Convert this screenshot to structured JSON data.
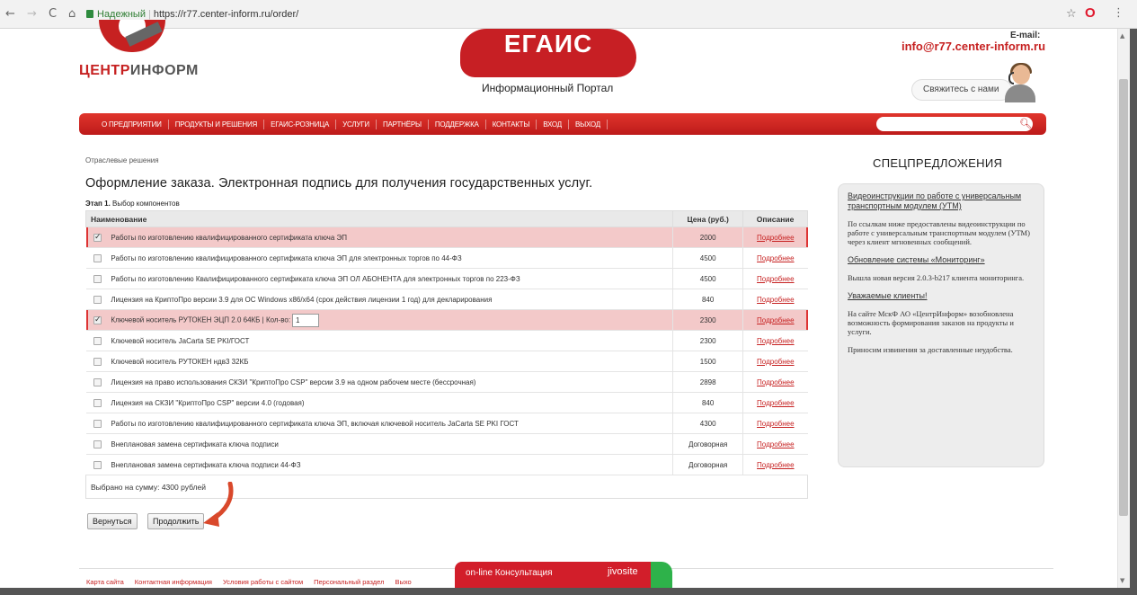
{
  "browser": {
    "back": "←",
    "forward": "→",
    "reload": "C",
    "home": "⌂",
    "secure_label": "Надежный",
    "url": "https://r77.center-inform.ru/order/",
    "star": "☆",
    "opera": "O",
    "menu": "⋮"
  },
  "header": {
    "logo_part1": "ЦЕНТР",
    "logo_part2": "ИНФОРМ",
    "egais": "ЕГАИС",
    "portal": "Информационный Портал",
    "email_label": "E-mail:",
    "email": "info@r77.center-inform.ru",
    "contact_button": "Свяжитесь с нами"
  },
  "nav": {
    "items": [
      "О ПРЕДПРИЯТИИ",
      "ПРОДУКТЫ И РЕШЕНИЯ",
      "ЕГАИС-РОЗНИЦА",
      "УСЛУГИ",
      "ПАРТНЁРЫ",
      "ПОДДЕРЖКА",
      "КОНТАКТЫ",
      "ВХОД",
      "ВЫХОД"
    ],
    "search_placeholder": ""
  },
  "main": {
    "breadcrumb": "Отраслевые решения",
    "title": "Оформление заказа. Электронная подпись для получения государственных услуг.",
    "stage_num": "Этап 1.",
    "stage_text": " Выбор компонентов",
    "table": {
      "headers": {
        "name": "Наименование",
        "price": "Цена (руб.)",
        "desc": "Описание"
      },
      "rows": [
        {
          "name": "Работы по изготовлению квалифицированного сертификата ключа ЭП",
          "price": "2000",
          "desc": "Подробнее",
          "checked": true
        },
        {
          "name": "Работы по изготовлению квалифицированного сертификата ключа ЭП для электронных торгов по 44-ФЗ",
          "price": "4500",
          "desc": "Подробнее",
          "checked": false
        },
        {
          "name": "Работы по изготовлению Квалифицированного сертификата ключа ЭП ОЛ АБОНЕНТА для электронных торгов по 223-ФЗ",
          "price": "4500",
          "desc": "Подробнее",
          "checked": false
        },
        {
          "name": "Лицензия на КриптоПро версии 3.9 для ОС Windows x86/x64 (срок действия лицензии 1 год) для декларирования",
          "price": "840",
          "desc": "Подробнее",
          "checked": false
        },
        {
          "name": "Ключевой носитель РУТОКЕН ЭЦП 2.0 64КБ | Кол-во:",
          "qty": "1",
          "price": "2300",
          "desc": "Подробнее",
          "checked": true
        },
        {
          "name": "Ключевой носитель JaCarta SE PKI/ГОСТ",
          "price": "2300",
          "desc": "Подробнее",
          "checked": false
        },
        {
          "name": "Ключевой носитель РУТОКЕН ндв3 32КБ",
          "price": "1500",
          "desc": "Подробнее",
          "checked": false
        },
        {
          "name": "Лицензия на право использования СКЗИ \"КриптоПро CSP\" версии 3.9 на одном рабочем месте (бессрочная)",
          "price": "2898",
          "desc": "Подробнее",
          "checked": false
        },
        {
          "name": "Лицензия на СКЗИ \"КриптоПро CSP\" версии 4.0 (годовая)",
          "price": "840",
          "desc": "Подробнее",
          "checked": false
        },
        {
          "name": "Работы по изготовлению квалифицированного сертификата ключа ЭП, включая ключевой носитель JaCarta SE PKI ГОСТ",
          "price": "4300",
          "desc": "Подробнее",
          "checked": false
        },
        {
          "name": "Внеплановая замена сертификата ключа подписи",
          "price": "Договорная",
          "desc": "Подробнее",
          "checked": false
        },
        {
          "name": "Внеплановая замена сертификата ключа подписи 44-ФЗ",
          "price": "Договорная",
          "desc": "Подробнее",
          "checked": false
        }
      ],
      "total": "Выбрано на сумму: 4300 рублей"
    },
    "back_button": "Вернуться",
    "continue_button": "Продолжить"
  },
  "sidebar": {
    "title": "СПЕЦПРЕДЛОЖЕНИЯ",
    "link1": "Видеоинструкции по работе с универсальным транспортным модулем (УТМ)",
    "text1": "По ссылкам ниже предоставлены видеоинструкции по работе с универсальным транспортным модулем (УТМ) через клиент мгновенных сообщений.",
    "link2": "Обновление системы «Мониторинг»",
    "text2": "Вышла новая версия 2.0.3-b217 клиента мониторинга.",
    "link3": "Уважаемые клиенты!",
    "text3": "На сайте МскФ АО «ЦентрИнформ» возобновлена возможность формирования заказов на продукты и услуги.",
    "text4": "Приносим извинения за доставленные неудобства."
  },
  "footer": {
    "links": [
      "Карта сайта",
      "Контактная информация",
      "Условия работы с сайтом",
      "Персональный раздел",
      "Выхо"
    ]
  },
  "jivo": {
    "label": "on-line Консультация",
    "brand": "jivosite"
  },
  "colors": {
    "brand_red": "#c62121",
    "highlight": "#f3c9c9",
    "jivo_green": "#2eb24a"
  }
}
